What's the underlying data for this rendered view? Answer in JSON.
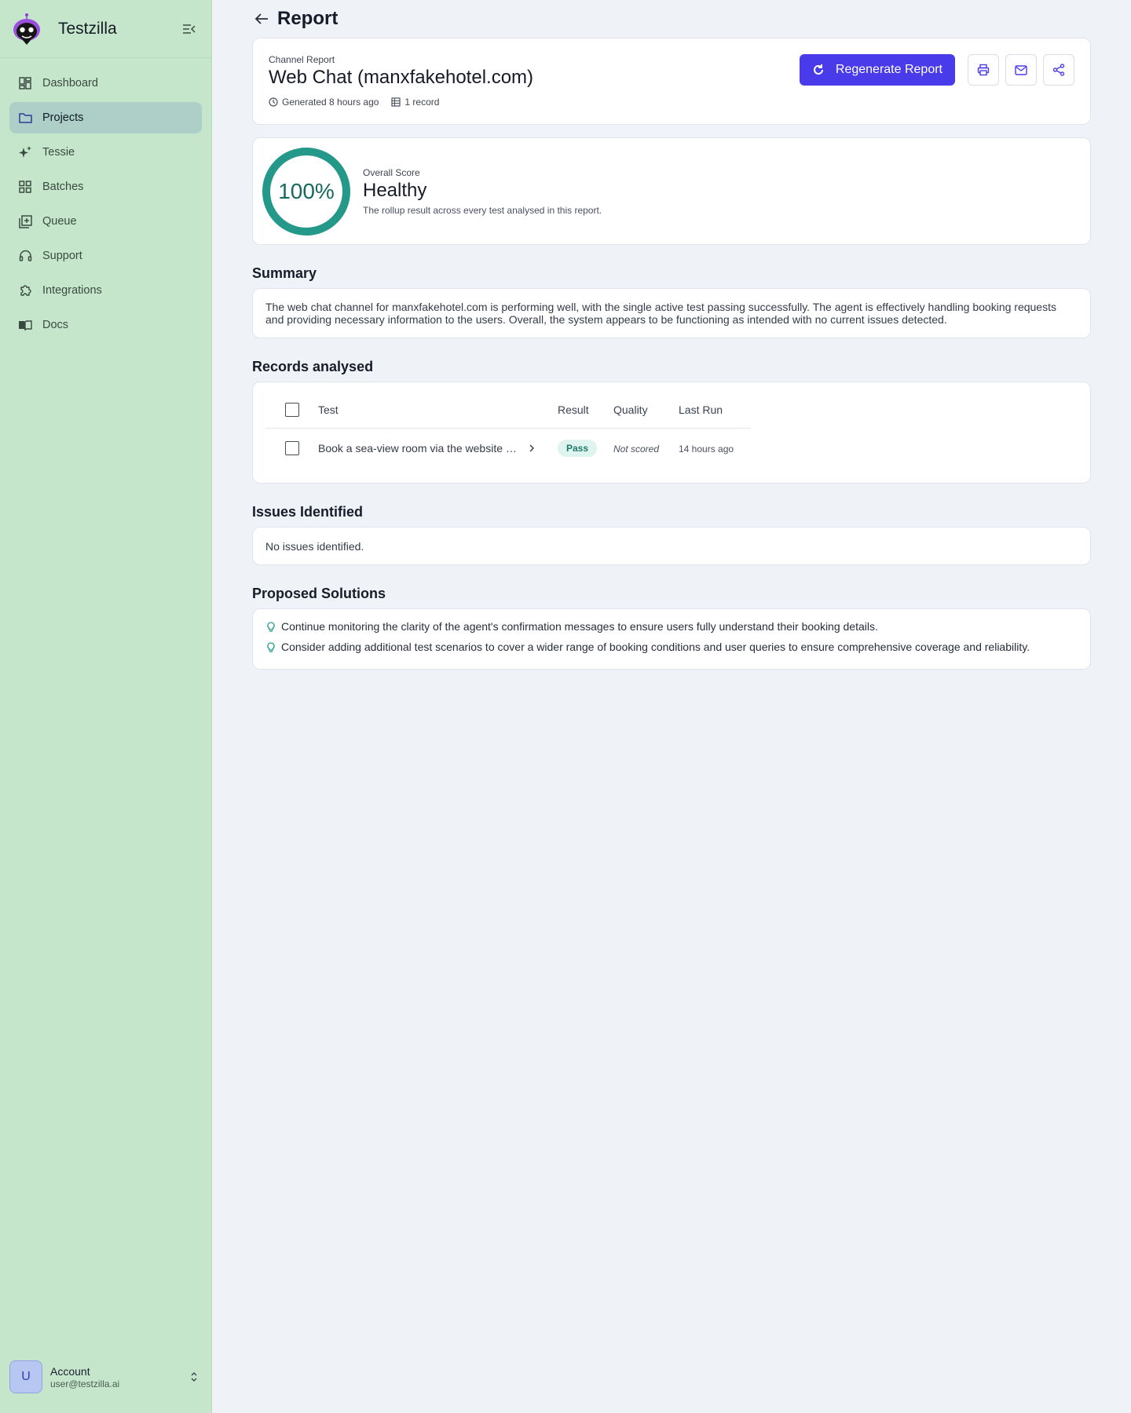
{
  "app": {
    "name": "Testzilla",
    "colors": {
      "sidebar": "#c6e6cb",
      "accent": "#4a3bea",
      "gauge": "#24998a",
      "pass": "#1f7a6c"
    }
  },
  "sidebar": {
    "items": [
      {
        "label": "Dashboard",
        "icon": "dashboard-icon",
        "active": false
      },
      {
        "label": "Projects",
        "icon": "folder-icon",
        "active": true
      },
      {
        "label": "Tessie",
        "icon": "sparkles-icon",
        "active": false
      },
      {
        "label": "Batches",
        "icon": "grid-icon",
        "active": false
      },
      {
        "label": "Queue",
        "icon": "queue-icon",
        "active": false
      },
      {
        "label": "Support",
        "icon": "headset-icon",
        "active": false
      },
      {
        "label": "Integrations",
        "icon": "puzzle-icon",
        "active": false
      },
      {
        "label": "Docs",
        "icon": "book-icon",
        "active": false
      }
    ],
    "account": {
      "initial": "U",
      "name": "Account",
      "email": "user@testzilla.ai"
    }
  },
  "page": {
    "title": "Report"
  },
  "report": {
    "eyebrow": "Channel Report",
    "title": "Web Chat (manxfakehotel.com)",
    "generated": "Generated 8 hours ago",
    "records_count": "1 record",
    "regenerate_label": "Regenerate Report"
  },
  "score": {
    "value_text": "100%",
    "value": 1.0,
    "label": "Overall Score",
    "status": "Healthy",
    "description": "The rollup result across every test analysed in this report."
  },
  "summary": {
    "title": "Summary",
    "text": "The web chat channel for manxfakehotel.com is performing well, with the single active test passing successfully. The agent is effectively handling booking requests and providing necessary information to the users. Overall, the system appears to be functioning as intended with no current issues detected."
  },
  "records": {
    "title": "Records analysed",
    "columns": [
      "Test",
      "Result",
      "Quality",
      "Last Run"
    ],
    "rows": [
      {
        "test": "Book a sea-view room via the website web chat",
        "result": "Pass",
        "quality": "Not scored",
        "last_run": "14 hours ago"
      }
    ]
  },
  "issues": {
    "title": "Issues Identified",
    "text": "No issues identified."
  },
  "solutions": {
    "title": "Proposed Solutions",
    "items": [
      "Continue monitoring the clarity of the agent's confirmation messages to ensure users fully understand their booking details.",
      "Consider adding additional test scenarios to cover a wider range of booking conditions and user queries to ensure comprehensive coverage and reliability."
    ]
  }
}
